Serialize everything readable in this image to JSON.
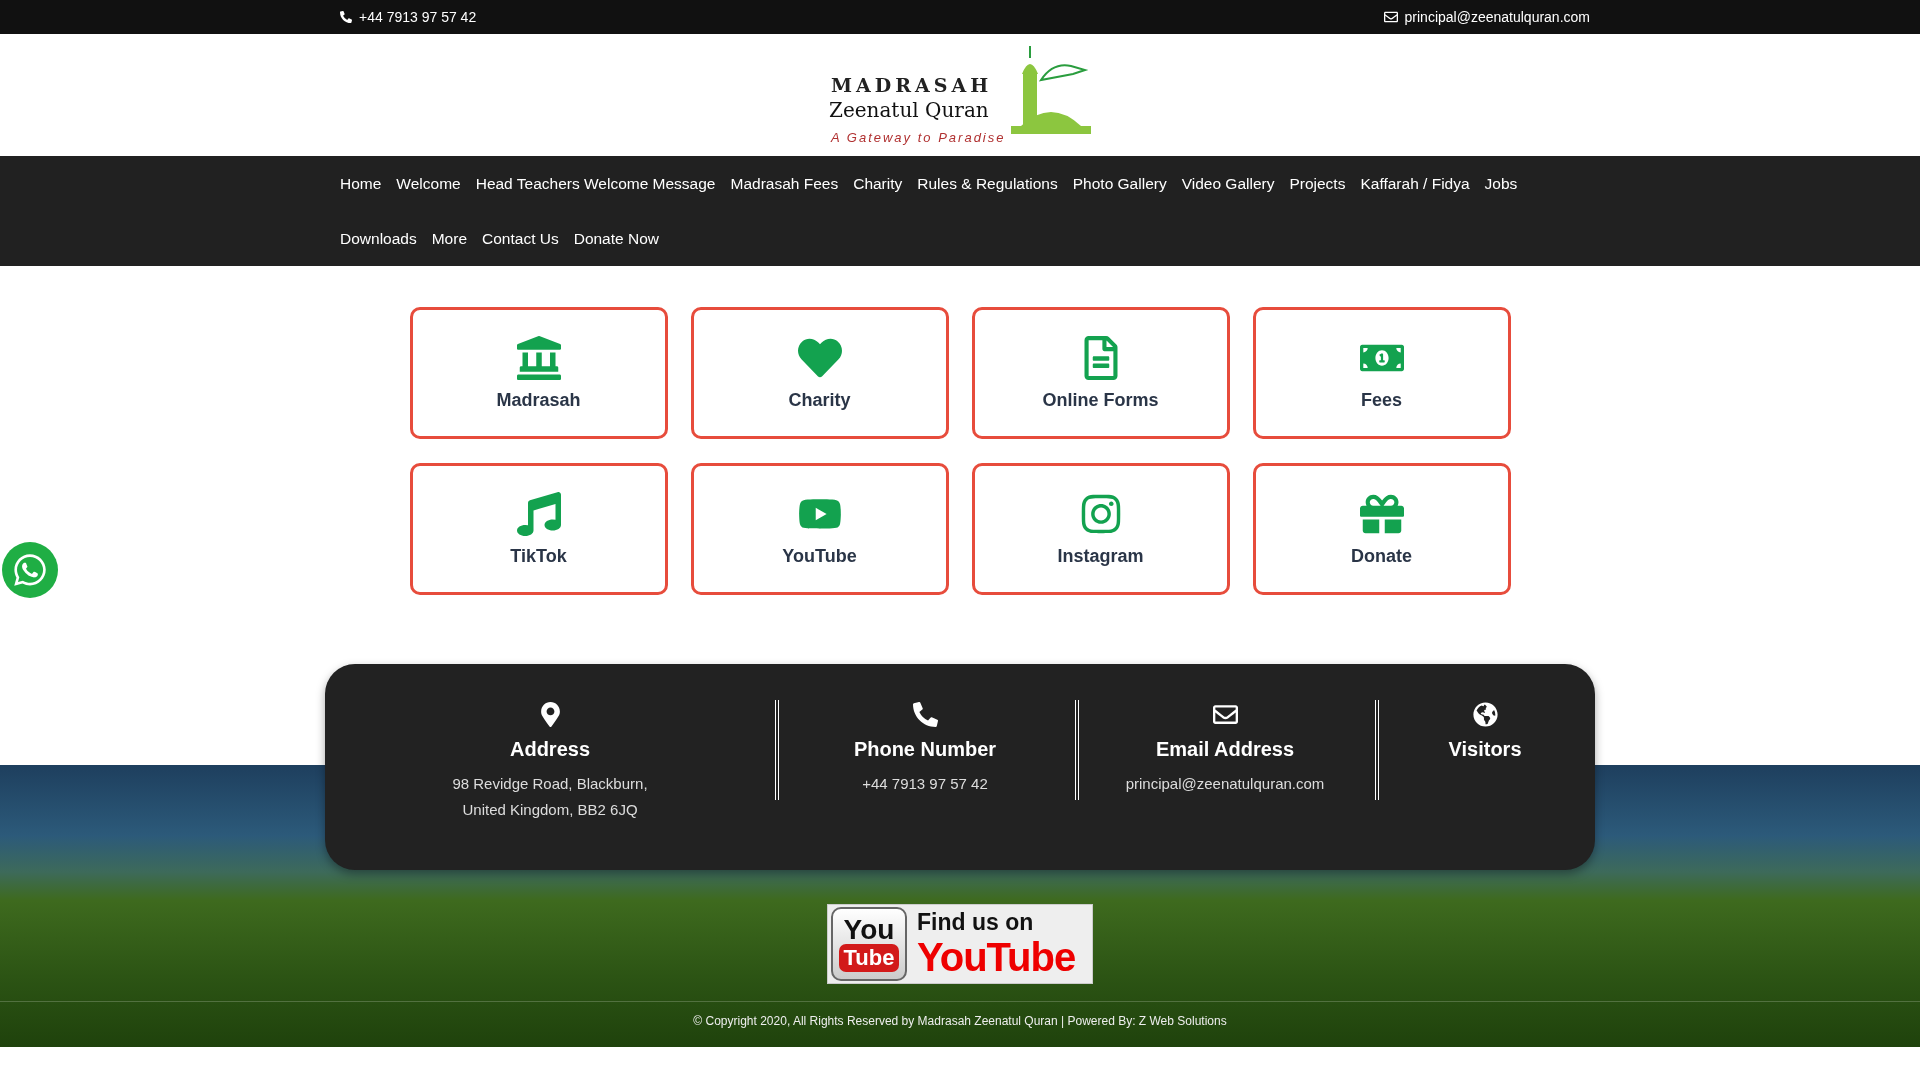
{
  "top_bar": {
    "phone": "+44 7913 97 57 42",
    "email": "principal@zeenatulquran.com"
  },
  "logo": {
    "line_1": "MADRASAH",
    "line_2": "Zeenatul Quran",
    "tagline": "A Gateway to Paradise"
  },
  "nav": [
    "Home",
    "Welcome",
    "Head Teachers Welcome Message",
    "Madrasah Fees",
    "Charity",
    "Rules & Regulations",
    "Photo Gallery",
    "Video Gallery",
    "Projects",
    "Kaffarah / Fidya",
    "Jobs",
    "Downloads",
    "More",
    "Contact Us",
    "Donate Now"
  ],
  "tiles": [
    {
      "label": "Madrasah"
    },
    {
      "label": "Charity"
    },
    {
      "label": "Online Forms"
    },
    {
      "label": "Fees"
    },
    {
      "label": "TikTok"
    },
    {
      "label": "YouTube"
    },
    {
      "label": "Instagram"
    },
    {
      "label": "Donate"
    }
  ],
  "contact_panel": [
    {
      "title": "Address",
      "lines": [
        "98 Revidge Road, Blackburn,",
        "United Kingdom, BB2 6JQ"
      ]
    },
    {
      "title": "Phone Number",
      "lines": [
        "+44 7913 97 57 42"
      ]
    },
    {
      "title": "Email Address",
      "lines": [
        "principal@zeenatulquran.com"
      ]
    },
    {
      "title": "Visitors"
    }
  ],
  "youtube_banner": {
    "logo_top": "You",
    "logo_bottom": "Tube",
    "caption": "Find us on",
    "brand": "YouTube"
  },
  "copyright": "© Copyright 2020, All Rights Reserved by Madrasah Zeenatul Quran | Powered By: Z Web Solutions"
}
